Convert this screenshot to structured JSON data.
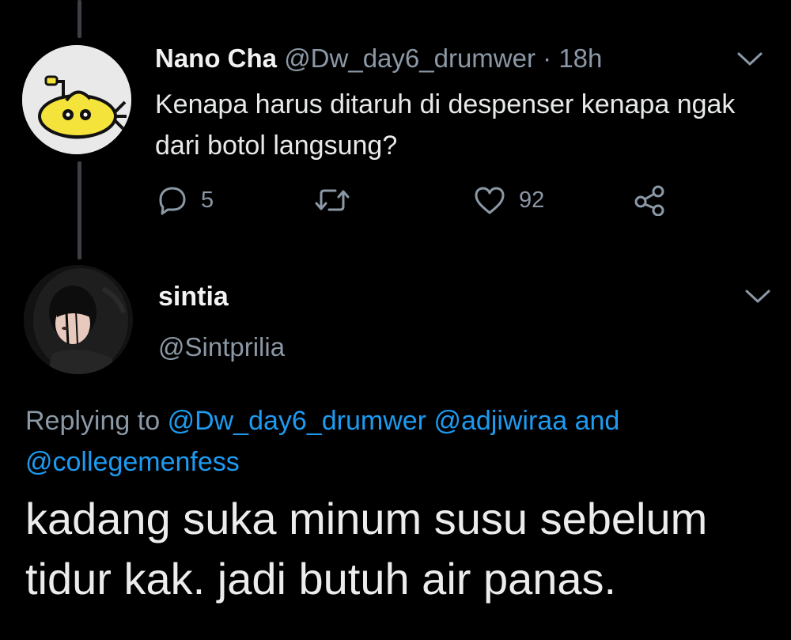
{
  "parent_tweet": {
    "display_name": "Nano Cha",
    "handle": "@Dw_day6_drumwer",
    "separator": "·",
    "time": "18h",
    "text": "Kenapa harus ditaruh di despenser kenapa ngak dari botol langsung?",
    "actions": {
      "reply_count": "5",
      "like_count": "92"
    },
    "avatar_icon": "yellow-submarine-icon"
  },
  "reply_tweet": {
    "display_name": "sintia",
    "handle": "@Sintprilia",
    "replying_prefix": "Replying to",
    "mention_1": "@Dw_day6_drumwer",
    "mention_2": "@adjiwiraa",
    "conjunction": "and",
    "mention_3": "@collegemenfess",
    "text": "kadang suka minum susu sebelum tidur kak. jadi butuh air panas."
  },
  "colors": {
    "background": "#000000",
    "text": "#e7e9ea",
    "muted": "#8b98a5",
    "link": "#1d9bf0",
    "thread_line": "#3d4147"
  }
}
